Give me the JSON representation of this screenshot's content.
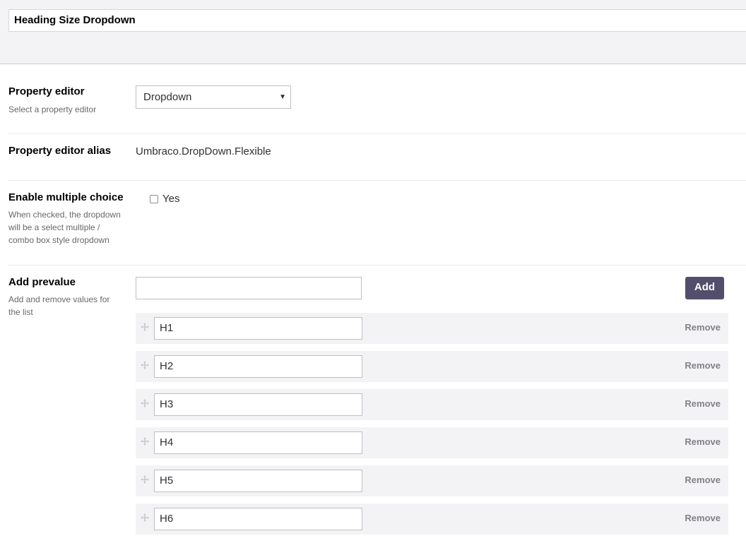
{
  "header": {
    "name_value": "Heading Size Dropdown"
  },
  "property_editor": {
    "label": "Property editor",
    "description": "Select a property editor",
    "selected": "Dropdown"
  },
  "property_editor_alias": {
    "label": "Property editor alias",
    "value": "Umbraco.DropDown.Flexible"
  },
  "multiple_choice": {
    "label": "Enable multiple choice",
    "description": "When checked, the dropdown will be a select multiple / combo box style dropdown",
    "checkbox_label": "Yes",
    "checked": false
  },
  "prevalues": {
    "label": "Add prevalue",
    "description": "Add and remove values for the list",
    "new_value": "",
    "add_label": "Add",
    "remove_label": "Remove",
    "items": [
      "H1",
      "H2",
      "H3",
      "H4",
      "H5",
      "H6"
    ]
  },
  "colors": {
    "band": "#f3f3f5",
    "button": "#544e6d",
    "text": "#000000",
    "muted": "#68676b"
  }
}
